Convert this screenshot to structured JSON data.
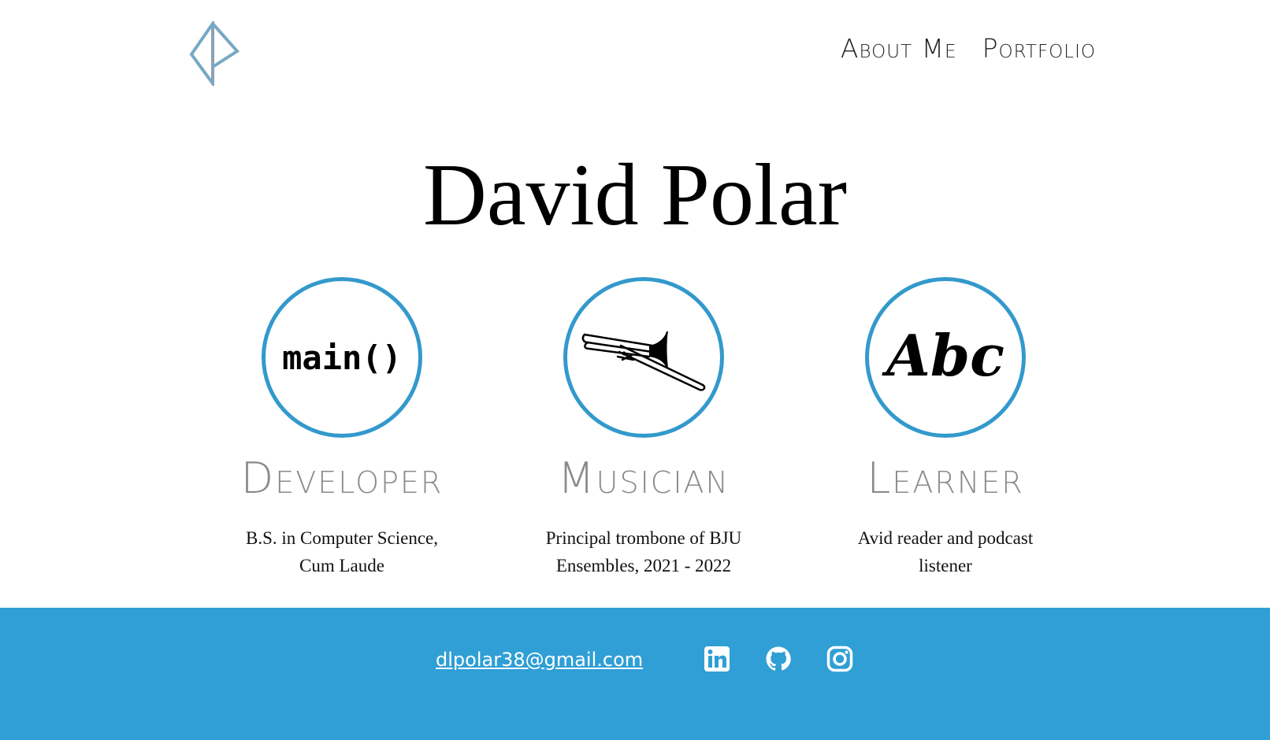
{
  "header": {
    "logo": "dp-diamond-logo",
    "nav": [
      {
        "label": "About Me"
      },
      {
        "label": "Portfolio"
      }
    ]
  },
  "hero": {
    "name": "David Polar"
  },
  "roles": [
    {
      "icon": "code-main-icon",
      "icon_text": "main()",
      "title": "Developer",
      "description": "B.S. in Computer Science, Cum Laude"
    },
    {
      "icon": "trombone-icon",
      "title": "Musician",
      "description": "Principal trombone of BJU Ensembles, 2021 - 2022"
    },
    {
      "icon": "abc-calligraphy-icon",
      "icon_text": "Abc",
      "title": "Learner",
      "description": "Avid reader and podcast listener"
    }
  ],
  "footer": {
    "email": "dlpolar38@gmail.com",
    "social": [
      {
        "icon": "linkedin-icon"
      },
      {
        "icon": "github-icon"
      },
      {
        "icon": "instagram-icon"
      }
    ]
  },
  "colors": {
    "accent": "#3399cc",
    "footer_bg": "#2f9fd6",
    "role_title": "#8a8a8a",
    "text": "#111111"
  }
}
